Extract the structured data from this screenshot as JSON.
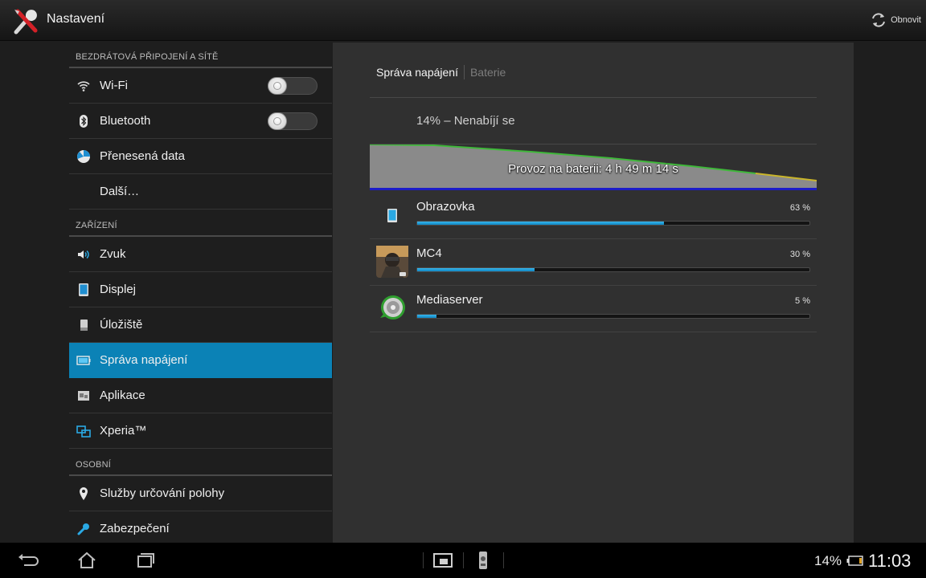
{
  "actionbar": {
    "title": "Nastavení",
    "app_icon": "tools-icon",
    "refresh_label": "Obnovit",
    "refresh_icon": "refresh-icon"
  },
  "sections": {
    "wireless": "BEZDRÁTOVÁ PŘIPOJENÍ A SÍTĚ",
    "device": "ZAŘÍZENÍ",
    "personal": "OSOBNÍ"
  },
  "items": {
    "wifi": {
      "label": "Wi-Fi",
      "icon": "wifi-icon",
      "toggle": "off"
    },
    "bluetooth": {
      "label": "Bluetooth",
      "icon": "bluetooth-icon",
      "toggle": "off"
    },
    "data": {
      "label": "Přenesená data",
      "icon": "data-usage-icon"
    },
    "more": {
      "label": "Další…"
    },
    "sound": {
      "label": "Zvuk",
      "icon": "speaker-icon"
    },
    "display": {
      "label": "Displej",
      "icon": "display-icon"
    },
    "storage": {
      "label": "Úložiště",
      "icon": "storage-icon"
    },
    "power": {
      "label": "Správa napájení",
      "icon": "battery-icon",
      "selected": true
    },
    "apps": {
      "label": "Aplikace",
      "icon": "apps-icon"
    },
    "xperia": {
      "label": "Xperia™",
      "icon": "xperia-icon"
    },
    "location": {
      "label": "Služby určování polohy",
      "icon": "location-pin-icon"
    },
    "security": {
      "label": "Zabezpečení",
      "icon": "security-icon"
    }
  },
  "detail": {
    "tabs": [
      "Správa napájení",
      "Baterie"
    ],
    "status": "14% – Nenabíjí se",
    "graph_label": "Provoz na baterii: 4 h 49 m 14 s",
    "usage": [
      {
        "name": "Obrazovka",
        "percent_label": "63 %",
        "percent": 63,
        "icon": "screen-icon"
      },
      {
        "name": "MC4",
        "percent_label": "30 %",
        "percent": 30,
        "icon": "mc4-game-icon"
      },
      {
        "name": "Mediaserver",
        "percent_label": "5 %",
        "percent": 5,
        "icon": "mediaserver-icon"
      }
    ]
  },
  "statusbar": {
    "battery_pct": "14%",
    "clock": "11:03"
  },
  "colors": {
    "accent": "#0b82b6",
    "bar_fill": "#2aa9e4",
    "graph_fill": "#8a8a8a",
    "graph_line": "#3fb83a"
  }
}
